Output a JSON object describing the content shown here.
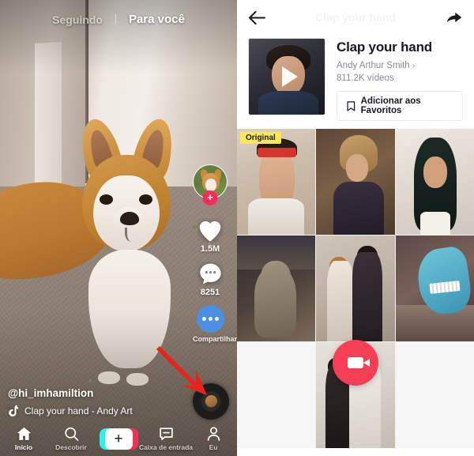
{
  "feed": {
    "tabs": [
      {
        "label": "Seguindo",
        "active": false
      },
      {
        "label": "Para você",
        "active": true
      }
    ],
    "handle": "@hi_imhamiltion",
    "sound_text": "Clap your hand - Andy Art",
    "sound_icon": "music-note-icon",
    "actions": {
      "avatar_icon": "profile-avatar-icon",
      "follow_badge": "+",
      "like_icon": "heart-icon",
      "like_count": "1.5M",
      "comment_icon": "comment-bubble-icon",
      "comment_count": "8251",
      "share_icon": "share-dots-icon",
      "share_label": "Compartilhar",
      "disc_icon": "spinning-record-icon"
    },
    "annotation": {
      "type": "red-arrow",
      "color": "#e8231c",
      "points_at": "spinning-record-disc"
    },
    "nav": [
      {
        "label": "Início",
        "icon": "home-icon",
        "active": true
      },
      {
        "label": "Descobrir",
        "icon": "search-icon",
        "active": false
      },
      {
        "label": "+",
        "icon": "create-plus-icon",
        "active": false
      },
      {
        "label": "Caixa de entrada",
        "icon": "inbox-message-icon",
        "active": false
      },
      {
        "label": "Eu",
        "icon": "person-icon",
        "active": false
      }
    ]
  },
  "sound_page": {
    "header": {
      "back_icon": "back-arrow-icon",
      "title_faded": "Clap your hand",
      "share_icon": "share-arrow-icon"
    },
    "cover": {
      "icon": "play-triangle-icon",
      "alt": "sound-cover-thumbnail"
    },
    "sound_name": "Clap your hand",
    "artist": "Andy Arthur Smith",
    "artist_chevron": "›",
    "video_count": "811.2K vídeos",
    "favorite_button": {
      "label": "Adicionar aos Favoritos",
      "icon": "bookmark-icon"
    },
    "grid": [
      {
        "id": "cell-1",
        "badge": "Original",
        "art": "c1"
      },
      {
        "id": "cell-2",
        "badge": "",
        "art": "c2"
      },
      {
        "id": "cell-3",
        "badge": "",
        "art": "c3"
      },
      {
        "id": "cell-4",
        "badge": "",
        "art": "c4"
      },
      {
        "id": "cell-5",
        "badge": "",
        "art": "c5"
      },
      {
        "id": "cell-6",
        "badge": "",
        "art": "c6"
      },
      {
        "id": "cell-7",
        "badge": "",
        "art": "c7"
      },
      {
        "id": "cell-8",
        "badge": "",
        "art": "c8"
      },
      {
        "id": "cell-9",
        "badge": "",
        "art": "c9"
      }
    ],
    "record_button": {
      "icon": "video-camera-icon",
      "color": "#f43f57"
    }
  },
  "colors": {
    "accent_pink": "#fe2c55",
    "accent_cyan": "#25f4ee",
    "share_blue": "#4a90e2",
    "badge_yellow": "#fbe94e",
    "text_dark": "#161823",
    "text_muted": "#8a8b91"
  }
}
